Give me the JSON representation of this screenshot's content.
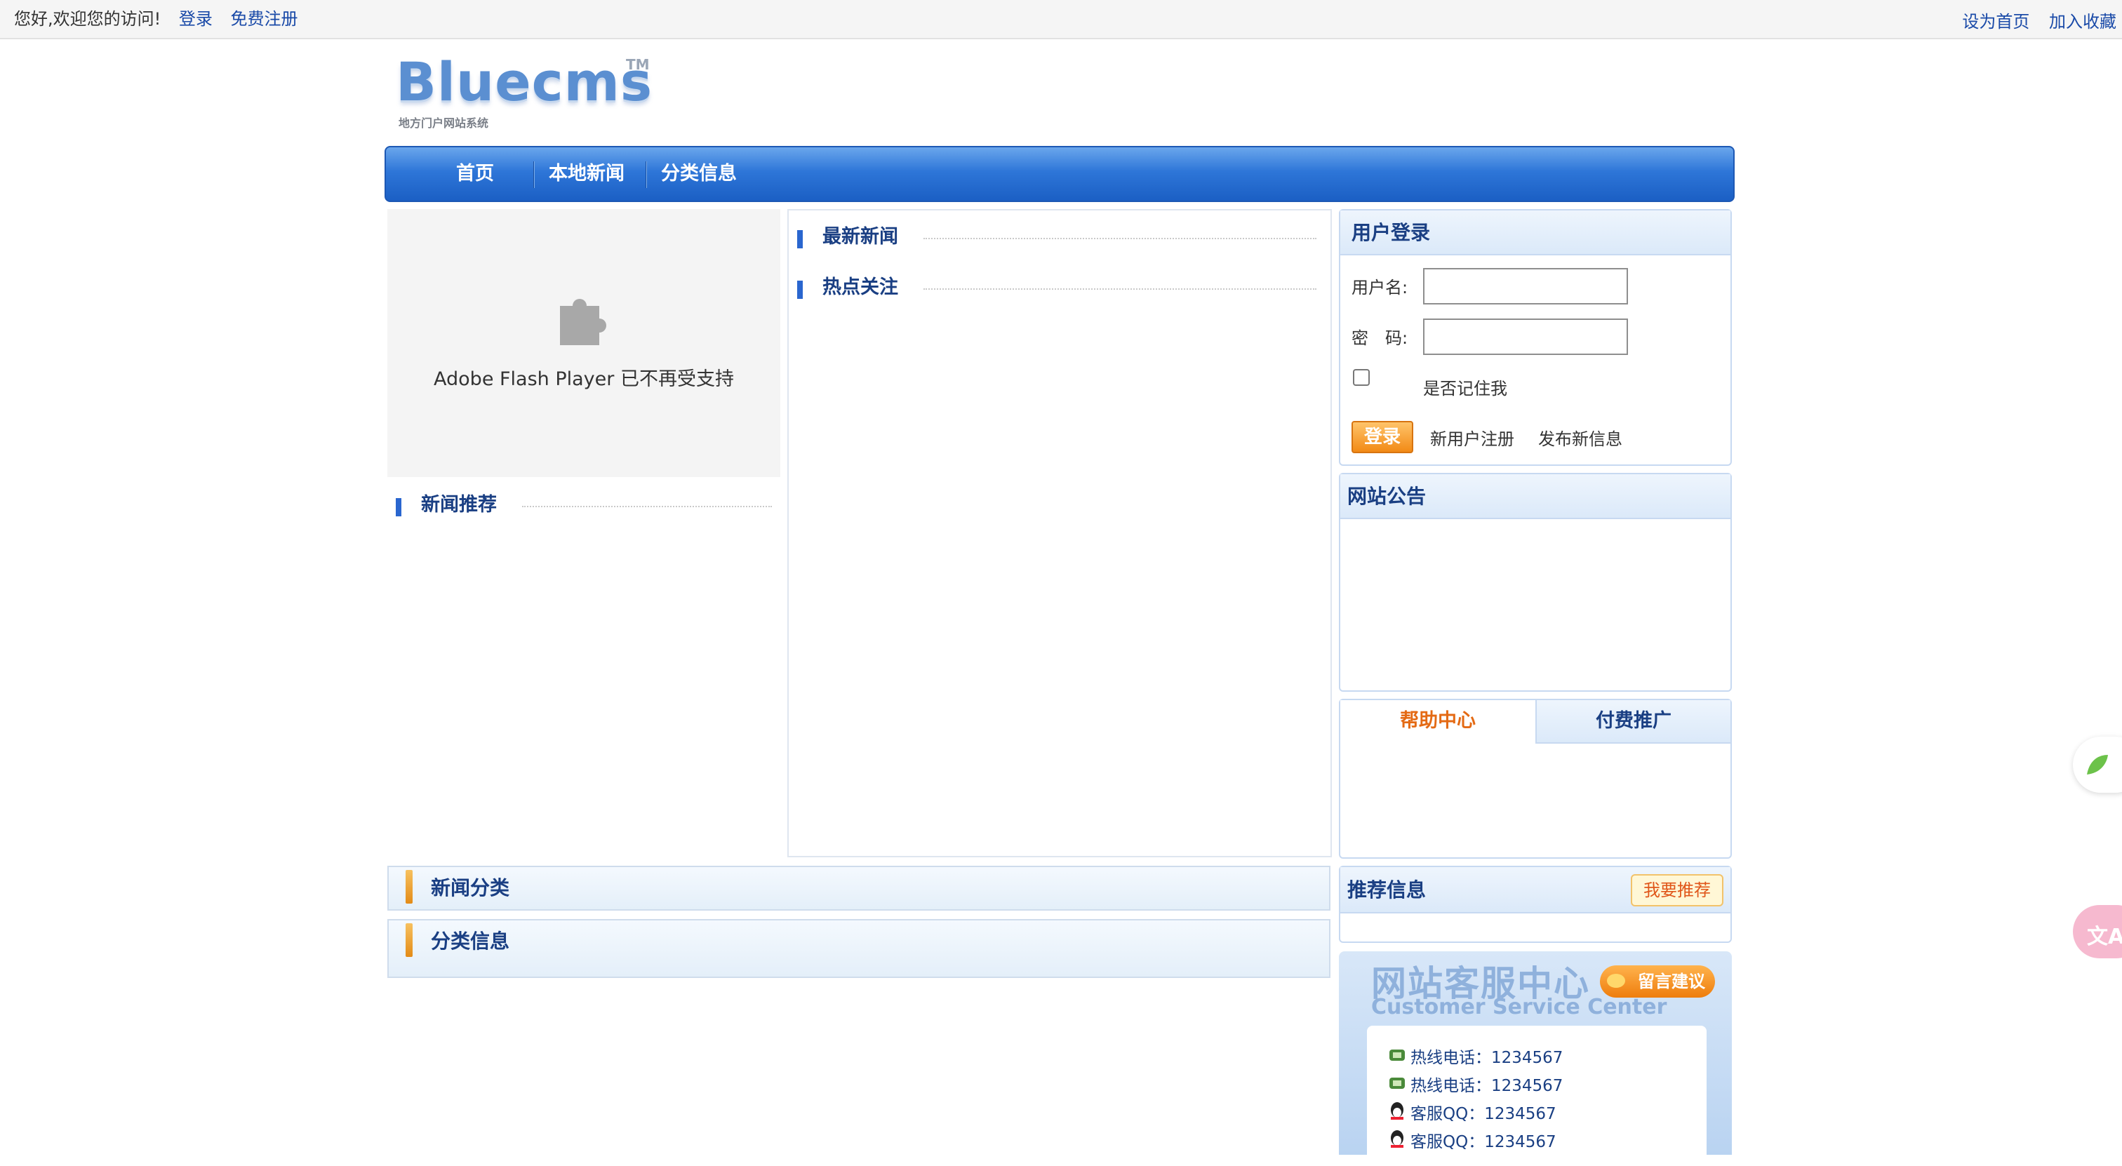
{
  "topbar": {
    "greeting": "您好,欢迎您的访问!",
    "login": "登录",
    "register": "免费注册",
    "set_home": "设为首页",
    "bookmark": "加入收藏"
  },
  "logo": {
    "word": "Bluecms",
    "tm": "TM",
    "subtitle": "地方门户网站系统"
  },
  "nav": {
    "items": [
      "首页",
      "本地新闻",
      "分类信息"
    ]
  },
  "flash": {
    "message": "Adobe Flash Player 已不再受支持"
  },
  "left": {
    "news_recommend": "新闻推荐"
  },
  "middle": {
    "latest_news": "最新新闻",
    "hot_topics": "热点关注"
  },
  "login_box": {
    "title": "用户登录",
    "username_label": "用户名:",
    "password_label": "密　码:",
    "remember_label": "是否记住我",
    "login_button": "登录",
    "register_link": "新用户注册",
    "post_link": "发布新信息"
  },
  "notice_box": {
    "title": "网站公告"
  },
  "tabs": {
    "help": "帮助中心",
    "paid": "付费推广"
  },
  "recommend": {
    "title": "推荐信息",
    "badge": "我要推荐"
  },
  "service": {
    "title_cn": "网站客服中心",
    "title_en": "Customer Service Center",
    "message_button": "留言建议",
    "lines": [
      "热线电话：1234567",
      "热线电话：1234567",
      "客服QQ：1234567",
      "客服QQ：1234567"
    ]
  },
  "categories": {
    "news_category": "新闻分类",
    "classified": "分类信息"
  },
  "float_widget": {
    "translate_label": "文A"
  },
  "colors": {
    "nav_blue": "#2e76d8",
    "link_blue": "#1a4aa8",
    "heading_blue": "#1a3f83",
    "orange": "#f28a16",
    "tab_orange": "#e46a14"
  }
}
